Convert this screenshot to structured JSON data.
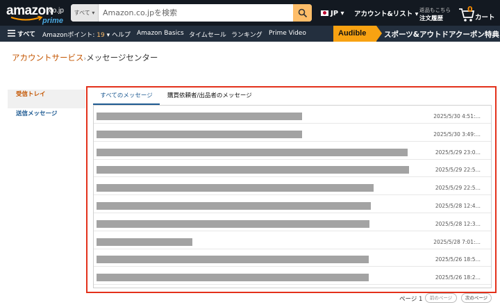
{
  "header": {
    "logo_text": "amazon",
    "logo_tld": ".co.jp",
    "logo_prime": "prime",
    "search_category": "すべて ▾",
    "search_placeholder": "Amazon.co.jpを検索",
    "language": "JP ▾",
    "account_label": "アカウント&リスト ▾",
    "orders_top": "返品もこちら",
    "orders_main": "注文履歴",
    "cart_count": "0",
    "cart_label": "カート"
  },
  "subnav": {
    "menu_label": "すべて",
    "points_label": "Amazonポイント: ",
    "points_value": "19",
    "points_suffix": "▾",
    "help": "ヘルプ",
    "basics": "Amazon Basics",
    "timesale": "タイムセール",
    "ranking": "ランキング",
    "prime_video": "Prime Video",
    "audible": "Audible",
    "promo": "スポーツ&アウトドアクーポン特典"
  },
  "breadcrumb": {
    "parent": "アカウントサービス",
    "separator": "›",
    "current": "メッセージセンター"
  },
  "leftnav": {
    "inbox": "受信トレイ",
    "sent": "送信メッセージ"
  },
  "tabs": {
    "all": "すべてのメッセージ",
    "buyer_seller": "購買依頼者/出品者のメッセージ"
  },
  "messages": [
    {
      "date": "2025/5/30 4:51:…",
      "redaction": 0.518
    },
    {
      "date": "2025/5/30 3:49:…",
      "redaction": 0.518
    },
    {
      "date": "2025/5/29 23:0…",
      "redaction": 0.783
    },
    {
      "date": "2025/5/29 22:5…",
      "redaction": 0.786
    },
    {
      "date": "2025/5/29 22:5…",
      "redaction": 0.697
    },
    {
      "date": "2025/5/28 12:4…",
      "redaction": 0.69
    },
    {
      "date": "2025/5/28 12:3…",
      "redaction": 0.687
    },
    {
      "date": "2025/5/28 7:01:…",
      "redaction": 0.241
    },
    {
      "date": "2025/5/26 18:5…",
      "redaction": 0.685
    },
    {
      "date": "2025/5/26 18:2…",
      "redaction": 0.685
    }
  ],
  "pagination": {
    "page_label": "ページ 1",
    "prev": "前のページ",
    "next": "次のページ"
  },
  "colors": {
    "nav_bg": "#131921",
    "subnav_bg": "#232f3e",
    "search_button": "#febd69",
    "accent_orange": "#c45500",
    "link_blue": "#1d5a92",
    "highlight_red": "#e3301a",
    "redaction_gray": "#a3a3a3"
  }
}
